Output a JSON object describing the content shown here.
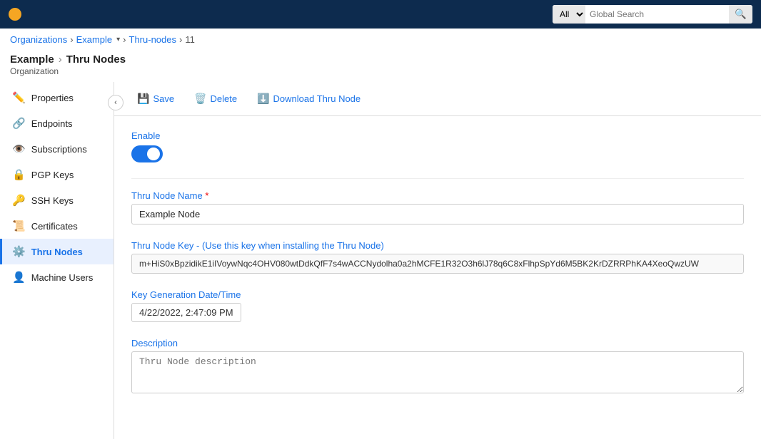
{
  "topnav": {
    "search_placeholder": "Global Search",
    "search_option": "All"
  },
  "breadcrumb": {
    "items": [
      "Organizations",
      "Example",
      "Thru-nodes",
      "11"
    ]
  },
  "page_title": {
    "org": "Example",
    "section": "Thru Nodes",
    "subtitle": "Organization"
  },
  "sidebar": {
    "items": [
      {
        "id": "properties",
        "label": "Properties",
        "icon": "✏️"
      },
      {
        "id": "endpoints",
        "label": "Endpoints",
        "icon": "🔗"
      },
      {
        "id": "subscriptions",
        "label": "Subscriptions",
        "icon": "👁️"
      },
      {
        "id": "pgpkeys",
        "label": "PGP Keys",
        "icon": "🔒"
      },
      {
        "id": "sshkeys",
        "label": "SSH Keys",
        "icon": "🔑"
      },
      {
        "id": "certificates",
        "label": "Certificates",
        "icon": "📜"
      },
      {
        "id": "thrunodes",
        "label": "Thru Nodes",
        "icon": "⚙️"
      },
      {
        "id": "machineusers",
        "label": "Machine Users",
        "icon": "👤"
      }
    ],
    "active": "thrunodes",
    "collapse_tooltip": "Collapse"
  },
  "toolbar": {
    "save_label": "Save",
    "delete_label": "Delete",
    "download_label": "Download Thru Node"
  },
  "form": {
    "enable_label": "Enable",
    "enable_state": true,
    "thru_node_name_label": "Thru Node Name",
    "thru_node_name_required": true,
    "thru_node_name_value": "Example Node",
    "thru_node_key_label": "Thru Node Key - (Use this key when installing the Thru Node)",
    "thru_node_key_value": "m+HiS0xBpzidikE1iIVoywNqc4OHV080wtDdkQfF7s4wACCNydolha0a2hMCFE1R32O3h6lJ78q6C8xFlhpSpYd6M5BK2KrDZRRPhKA4XeoQwzUW",
    "key_gen_label": "Key Generation Date/Time",
    "key_gen_value": "4/22/2022, 2:47:09 PM",
    "description_label": "Description",
    "description_placeholder": "Thru Node description"
  }
}
